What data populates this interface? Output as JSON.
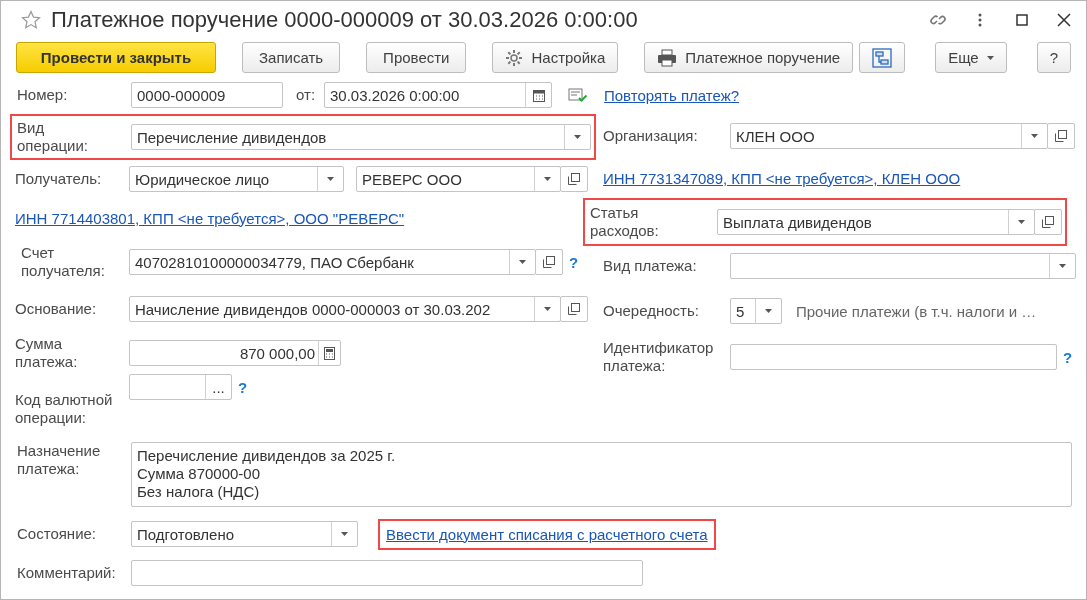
{
  "window": {
    "title": "Платежное поручение 0000-000009 от 30.03.2026 0:00:00"
  },
  "toolbar": [
    {
      "kind": "primary",
      "label": "Провести и закрыть"
    },
    {
      "kind": "plain",
      "label": "Записать"
    },
    {
      "kind": "plain",
      "label": "Провести"
    },
    {
      "kind": "settings",
      "label": "Настройка"
    },
    {
      "kind": "print",
      "label": "Платежное поручение"
    },
    {
      "kind": "structure"
    },
    {
      "kind": "more",
      "label": "Еще"
    },
    {
      "kind": "plain",
      "label": "?"
    }
  ],
  "header": {
    "number_label": "Номер:",
    "number": "0000-000009",
    "date_label": "от:",
    "date": "30.03.2026  0:00:00",
    "repeat_link": "Повторять платеж?"
  },
  "left": [
    {
      "kind": "select",
      "label": "Вид операции:",
      "value": "Перечисление дивидендов",
      "highlighted": true
    },
    {
      "kind": "recipient",
      "label": "Получатель:",
      "type_value": "Юридическое лицо",
      "value": "РЕВЕРС ООО",
      "highlighted": false
    },
    {
      "kind": "link",
      "text": "ИНН 7714403801, КПП <не требуется>, ООО \"РЕВЕРС\"",
      "highlighted": false
    },
    {
      "kind": "account",
      "label": "Счет получателя:",
      "value": "40702810100000034779, ПАО Сбербанк",
      "help": "?",
      "highlighted": false
    },
    {
      "kind": "basis",
      "label": "Основание:",
      "value": "Начисление дивидендов 0000-000003 от 30.03.202",
      "highlighted": false
    },
    {
      "kind": "amount",
      "label": "Сумма платежа:",
      "value": "870 000,00",
      "highlighted": false
    },
    {
      "kind": "code",
      "label": "Код валютной операции:",
      "button": "...",
      "help": "?",
      "highlighted": false
    }
  ],
  "right": [
    {
      "kind": "org",
      "label": "Организация:",
      "value": "КЛЕН ООО",
      "highlighted": false
    },
    {
      "kind": "link",
      "text": "ИНН 7731347089, КПП <не требуется>, КЛЕН ООО",
      "highlighted": false
    },
    {
      "kind": "org",
      "label": "Статья расходов:",
      "value": "Выплата дивидендов",
      "highlighted": true
    },
    {
      "kind": "payment_type",
      "label": "Вид платежа:",
      "highlighted": false
    },
    {
      "kind": "priority",
      "label": "Очередность:",
      "value": "5",
      "note": "Прочие платежи (в т.ч. налоги и …",
      "highlighted": false
    },
    {
      "kind": "identifier",
      "label": "Идентификатор платежа:",
      "help": "?",
      "highlighted": false
    }
  ],
  "purpose": {
    "label": "Назначение платежа:",
    "lines": [
      "Перечисление дивидендов за 2025 г.",
      "Сумма 870000-00",
      "Без налога (НДС)"
    ]
  },
  "status": {
    "label": "Состояние:",
    "value": "Подготовлено",
    "link": "Ввести документ списания с расчетного счета",
    "link_highlighted": true
  },
  "comment": {
    "label": "Комментарий:"
  }
}
